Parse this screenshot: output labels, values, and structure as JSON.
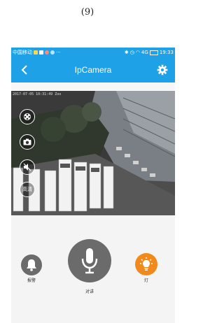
{
  "figure_label": "(9)",
  "status_bar": {
    "carrier": "中国移动",
    "extra": "···",
    "signal": "4G",
    "time": "19:33"
  },
  "app_bar": {
    "title": "IpCamera"
  },
  "video": {
    "timestamp": "2017-07-05 10:31:49 Zoo"
  },
  "side_controls": {
    "hd_label": "高清"
  },
  "bottom_controls": {
    "alarm_label": "报警",
    "talk_label": "对讲",
    "light_label": "灯"
  },
  "colors": {
    "brand_blue": "#1ea1e7",
    "button_gray": "#6b6b6b",
    "light_orange": "#f08a1c"
  },
  "icons": [
    "back-icon",
    "gear-icon",
    "film-reel-icon",
    "camera-icon",
    "mute-icon",
    "bell-icon",
    "microphone-icon",
    "light-bulb-icon"
  ]
}
